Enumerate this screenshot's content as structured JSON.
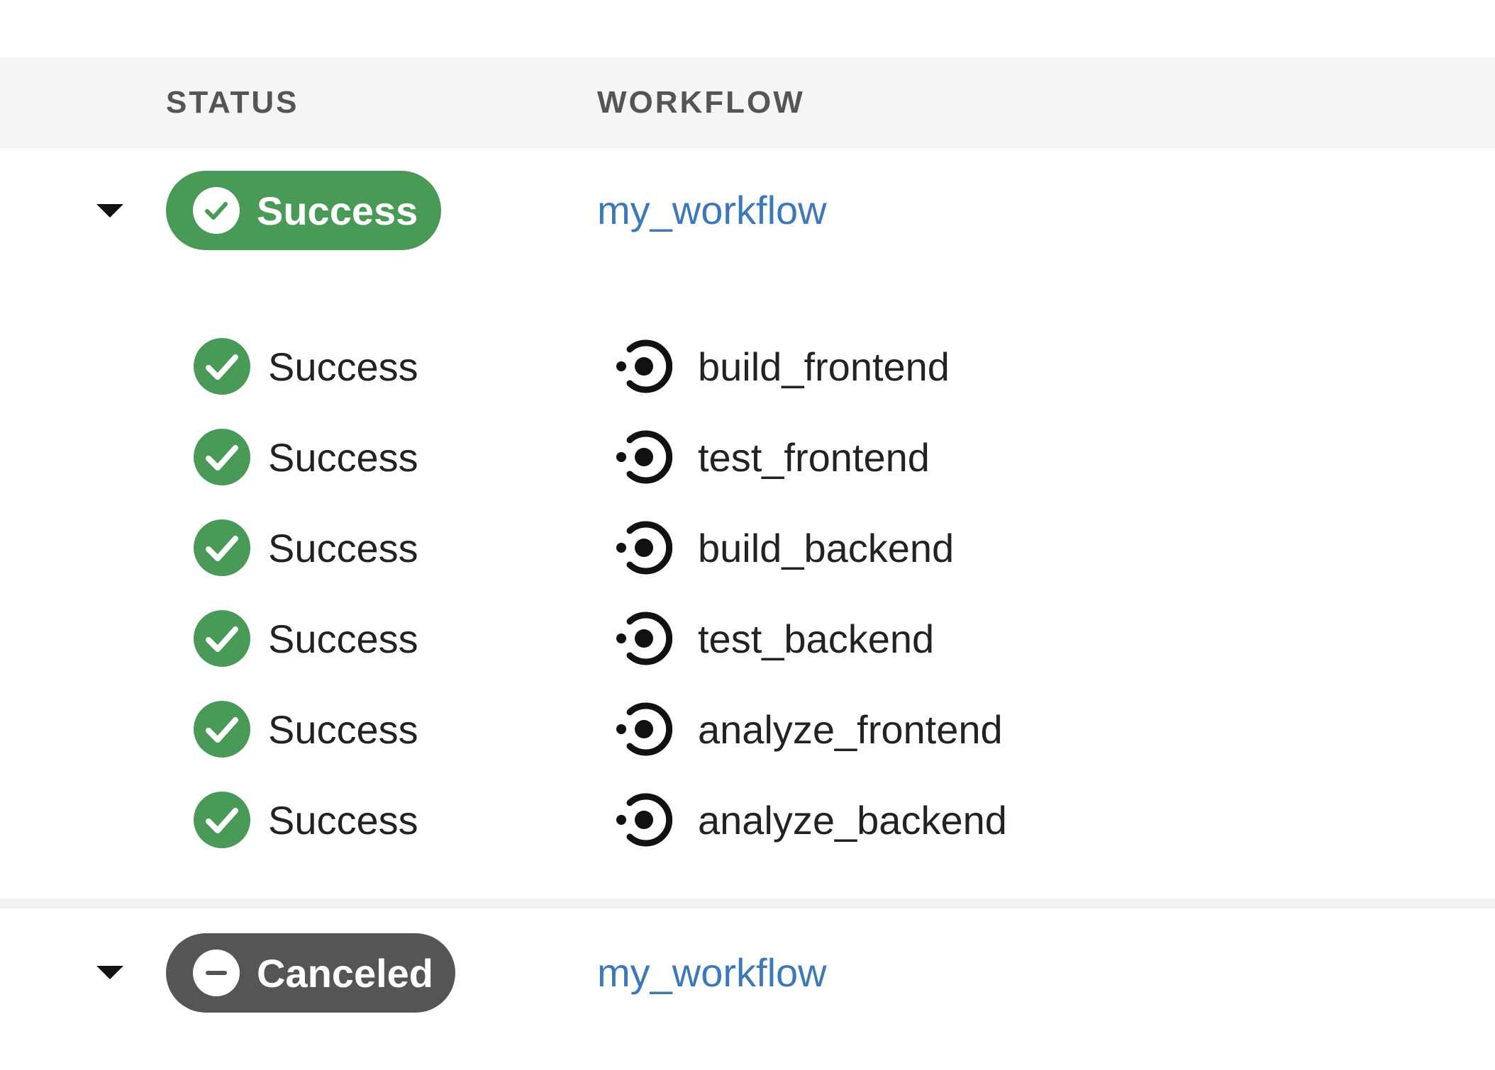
{
  "table": {
    "headers": {
      "status": "STATUS",
      "workflow": "WORKFLOW"
    }
  },
  "colors": {
    "success": "#4a9a57",
    "canceled": "#555555",
    "link": "#3d79b8"
  },
  "workflows": [
    {
      "status": "Success",
      "status_icon": "check-circle-icon",
      "name": "my_workflow",
      "expanded": true,
      "jobs": [
        {
          "status": "Success",
          "name": "build_frontend"
        },
        {
          "status": "Success",
          "name": "test_frontend"
        },
        {
          "status": "Success",
          "name": "build_backend"
        },
        {
          "status": "Success",
          "name": "test_backend"
        },
        {
          "status": "Success",
          "name": "analyze_frontend"
        },
        {
          "status": "Success",
          "name": "analyze_backend"
        }
      ]
    },
    {
      "status": "Canceled",
      "status_icon": "minus-circle-icon",
      "name": "my_workflow",
      "expanded": true,
      "jobs": []
    }
  ]
}
